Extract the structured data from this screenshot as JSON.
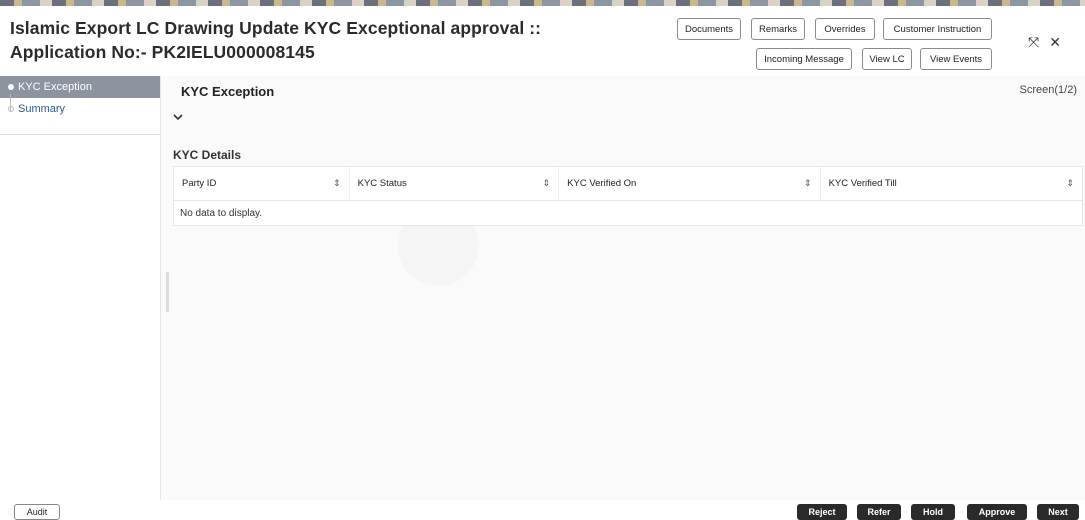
{
  "window": {
    "title_line1": "Islamic Export LC Drawing Update KYC Exceptional approval ::",
    "title_line2": "Application No:- PK2IELU000008145"
  },
  "header_buttons": {
    "documents": "Documents",
    "remarks": "Remarks",
    "overrides": "Overrides",
    "customer_instruction": "Customer Instruction",
    "incoming_message": "Incoming Message",
    "view_lc": "View LC",
    "view_events": "View Events"
  },
  "window_icons": {
    "minimize": "⤧",
    "close": "✕"
  },
  "sidebar": {
    "items": [
      {
        "label": "KYC Exception",
        "active": true
      },
      {
        "label": "Summary",
        "active": false
      }
    ]
  },
  "main": {
    "section_title": "KYC Exception",
    "screen_indicator": "Screen(1/2)",
    "collapse_icon": "chevron-down-icon",
    "kyc_details_label": "KYC Details",
    "table": {
      "columns": [
        {
          "label": "Party ID"
        },
        {
          "label": "KYC Status"
        },
        {
          "label": "KYC Verified On"
        },
        {
          "label": "KYC Verified Till"
        }
      ],
      "empty_text": "No data to display."
    }
  },
  "footer": {
    "audit": "Audit",
    "reject": "Reject",
    "refer": "Refer",
    "hold": "Hold",
    "approve": "Approve",
    "next": "Next"
  },
  "colors": {
    "sidebar_active": "#8d94a0",
    "link": "#2a5f8f",
    "footer_button": "#2a2a2a"
  }
}
